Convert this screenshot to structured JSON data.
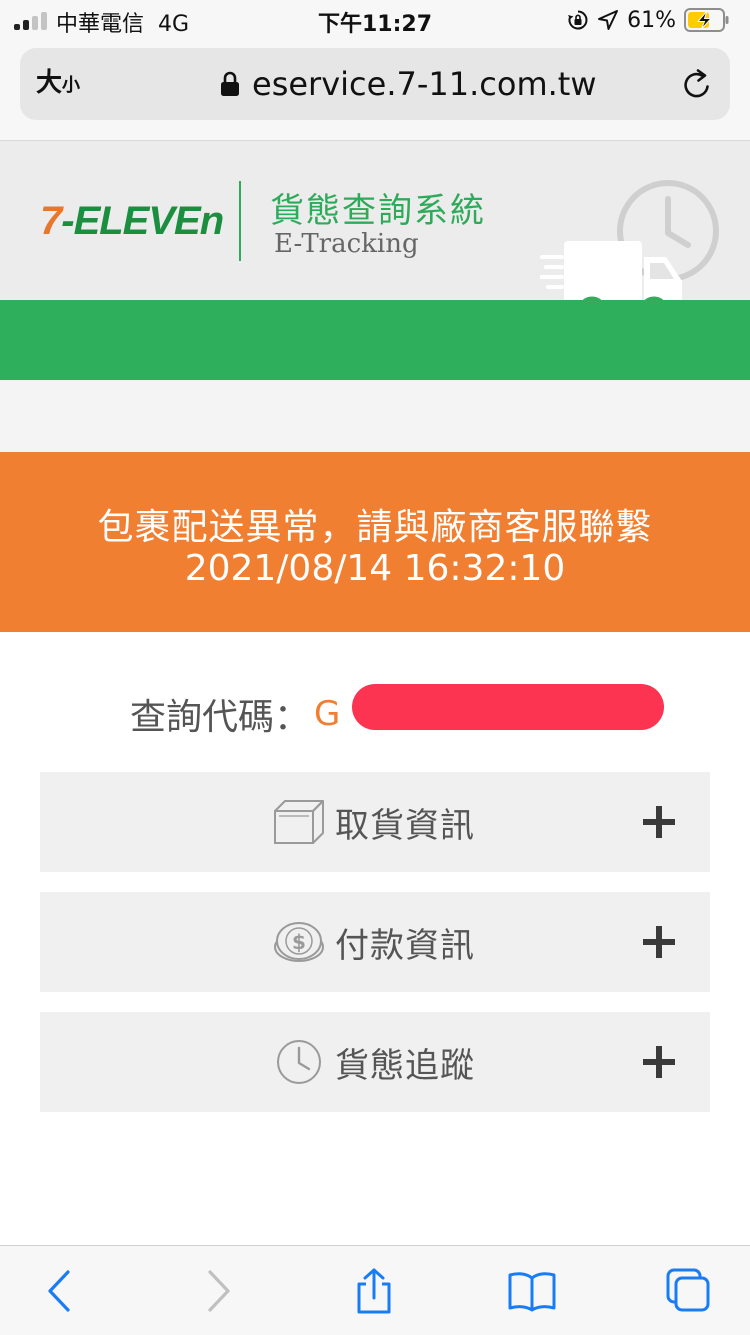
{
  "status_bar": {
    "carrier": "中華電信",
    "network": "4G",
    "time": "下午11:27",
    "battery_percent": "61%",
    "signal_bars_active": 2,
    "signal_bars_total": 4
  },
  "browser": {
    "text_size_label": "大",
    "text_size_label_small": "小",
    "url": "eservice.7-11.com.tw"
  },
  "header": {
    "logo_seven": "7",
    "logo_text": "-ELEVEn",
    "title": "貨態查詢系統",
    "subtitle": "E-Tracking"
  },
  "banner": {
    "message": "包裹配送異常，請與廠商客服聯繫",
    "timestamp": "2021/08/14 16:32:10"
  },
  "query": {
    "label": "查詢代碼：",
    "code_visible": "G"
  },
  "panels": [
    {
      "label": "取貨資訊",
      "icon": "package-box-icon"
    },
    {
      "label": "付款資訊",
      "icon": "coin-dollar-icon"
    },
    {
      "label": "貨態追蹤",
      "icon": "clock-icon"
    }
  ],
  "toolbar": {
    "icons": [
      "back-icon",
      "forward-icon",
      "share-icon",
      "bookmarks-icon",
      "tabs-icon"
    ]
  },
  "colors": {
    "brand_green": "#2daf5c",
    "banner_orange": "#f07f32",
    "redaction": "#fc3452",
    "safari_blue": "#1a7cf5"
  }
}
